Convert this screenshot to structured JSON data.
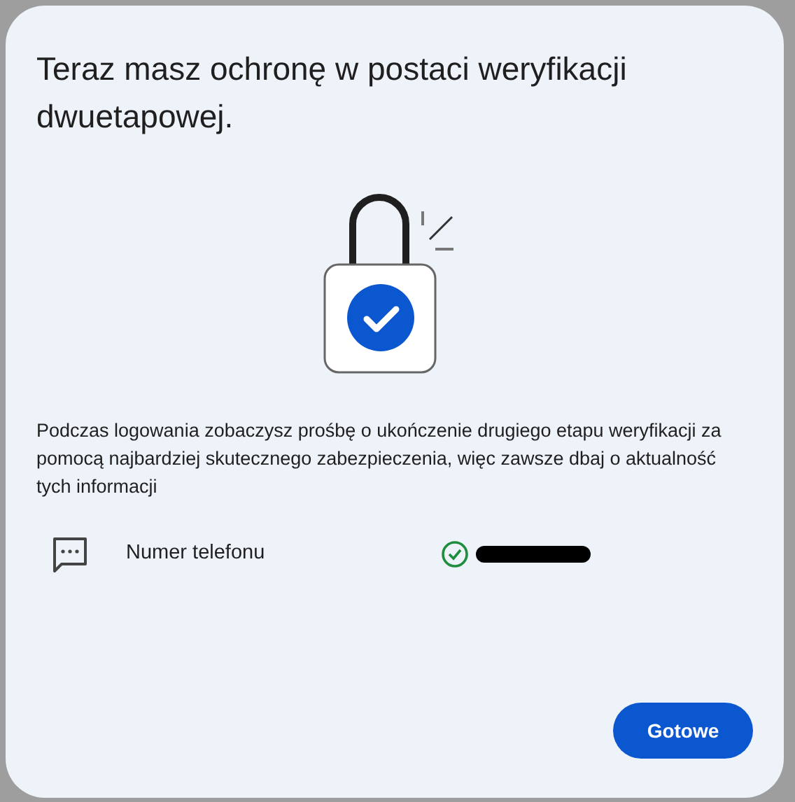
{
  "dialog": {
    "title": "Teraz masz ochronę w postaci weryfikacji dwuetapowej.",
    "description": "Podczas logowania zobaczysz prośbę o ukończenie drugiego etapu weryfikacji za pomocą najbardziej skutecznego zabezpieczenia, więc zawsze dbaj o aktualność tych informacji",
    "methods": [
      {
        "label": "Numer telefonu",
        "verified": true,
        "value_redacted": true
      }
    ],
    "buttons": [
      "Gotowe"
    ]
  }
}
